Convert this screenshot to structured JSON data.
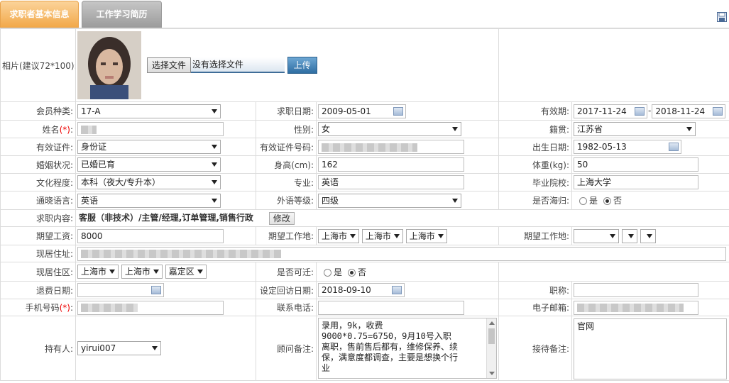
{
  "tabs": [
    "求职者基本信息",
    "工作学习简历"
  ],
  "photo": {
    "label": "相片(建议72*100):",
    "choose_button": "选择文件",
    "no_file": "没有选择文件",
    "upload_button": "上传"
  },
  "member_type": {
    "label": "会员种类:",
    "value": "17-A"
  },
  "apply_date": {
    "label": "求职日期:",
    "value": "2009-05-01"
  },
  "validity": {
    "label": "有效期:",
    "start": "2017-11-24",
    "sep": "-",
    "end": "2018-11-24"
  },
  "name": {
    "label": "姓名",
    "req": "(*)",
    "colon": ":"
  },
  "gender": {
    "label": "性别:",
    "value": "女"
  },
  "origin": {
    "label": "籍贯:",
    "value": "江苏省"
  },
  "id_type": {
    "label": "有效证件:",
    "value": "身份证"
  },
  "id_number": {
    "label": "有效证件号码:"
  },
  "birth": {
    "label": "出生日期:",
    "value": "1982-05-13"
  },
  "marital": {
    "label": "婚姻状况:",
    "value": "已婚已育"
  },
  "height": {
    "label": "身高(cm):",
    "value": "162"
  },
  "weight": {
    "label": "体重(kg):",
    "value": "50"
  },
  "education": {
    "label": "文化程度:",
    "value": "本科（夜大/专升本）"
  },
  "major": {
    "label": "专业:",
    "value": "英语"
  },
  "school": {
    "label": "毕业院校:",
    "value": "上海大学"
  },
  "language": {
    "label": "通晓语言:",
    "value": "英语"
  },
  "foreign_level": {
    "label": "外语等级:",
    "value": "四级"
  },
  "returnee": {
    "label": "是否海归:",
    "yes": "是",
    "no": "否"
  },
  "job_content": {
    "label": "求职内容:",
    "value": "客服（非技术）/主管/经理,订单管理,销售行政",
    "edit_button": "修改"
  },
  "salary": {
    "label": "期望工资:",
    "value": "8000"
  },
  "work_place": {
    "label": "期望工作地:",
    "v1": "上海市",
    "v2": "上海市",
    "v3": "上海市"
  },
  "work_place2": {
    "label": "期望工作地:"
  },
  "address": {
    "label": "现居住址:"
  },
  "district": {
    "label": "现居住区:",
    "v1": "上海市",
    "v2": "上海市",
    "v3": "嘉定区"
  },
  "relocate": {
    "label": "是否可迁:",
    "yes": "是",
    "no": "否"
  },
  "refund_date": {
    "label": "退费日期:"
  },
  "visit_date": {
    "label": "设定回访日期:",
    "value": "2018-09-10"
  },
  "title": {
    "label": "职称:"
  },
  "mobile": {
    "label": "手机号码",
    "req": "(*)",
    "colon": ":"
  },
  "phone": {
    "label": "联系电话:"
  },
  "email": {
    "label": "电子邮箱:"
  },
  "holder": {
    "label": "持有人:",
    "value": "yirui007"
  },
  "consultant_note": {
    "label": "顾问备注:",
    "value": "录用，9k，收费\n9000*0.75=6750，9月10号入职\n离职，售前售后都有，维修保养、续\n保，满意度都调查，主要是想换个行\n业"
  },
  "reception_note": {
    "label": "接待备注:",
    "value": "官网"
  }
}
